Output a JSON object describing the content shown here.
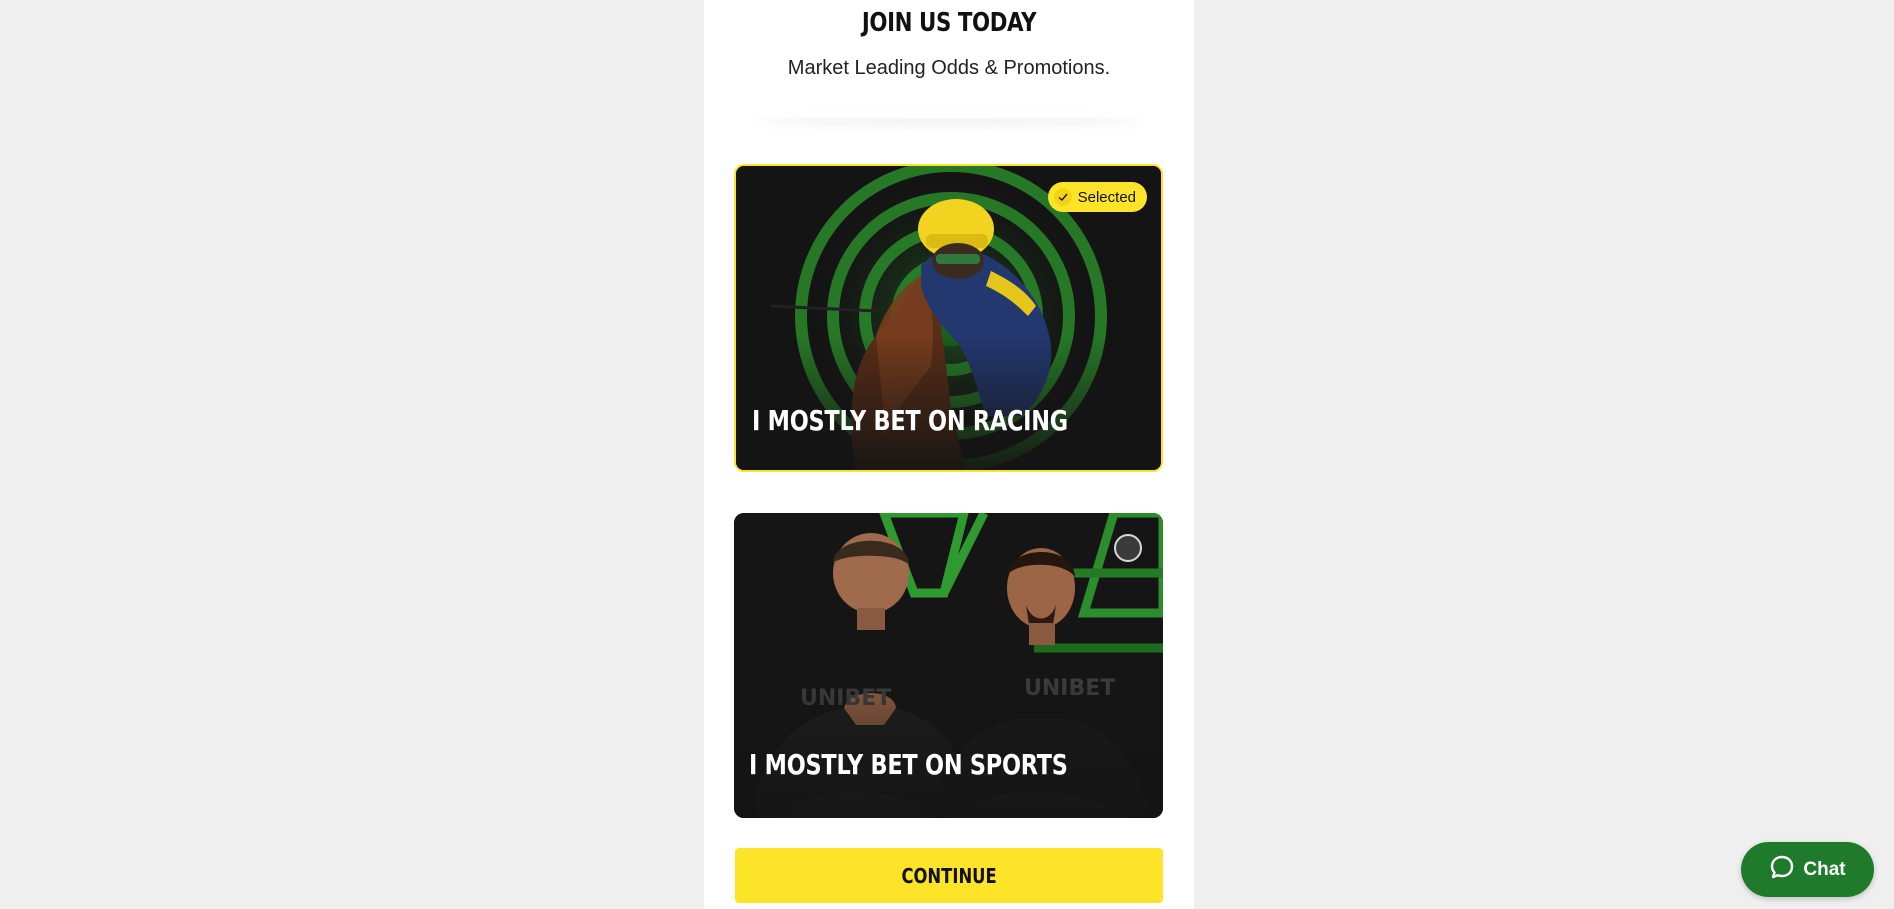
{
  "header": {
    "title": "JOIN US TODAY",
    "subtitle": "Market Leading Odds & Promotions."
  },
  "options": [
    {
      "label": "I MOSTLY BET ON RACING",
      "selected": true,
      "badge_text": "Selected",
      "image": "jockey-on-horse"
    },
    {
      "label": "I MOSTLY BET ON SPORTS",
      "selected": false,
      "image": "two-ambassadors",
      "shirt_text": "UNIBET"
    }
  ],
  "continue_label": "CONTINUE",
  "chat": {
    "label": "Chat",
    "icon": "chat-bubble-icon"
  },
  "colors": {
    "accent_yellow": "#fde428",
    "brand_green": "#1f7a2c",
    "card_dark": "#141414",
    "page_bg": "#efefef"
  }
}
